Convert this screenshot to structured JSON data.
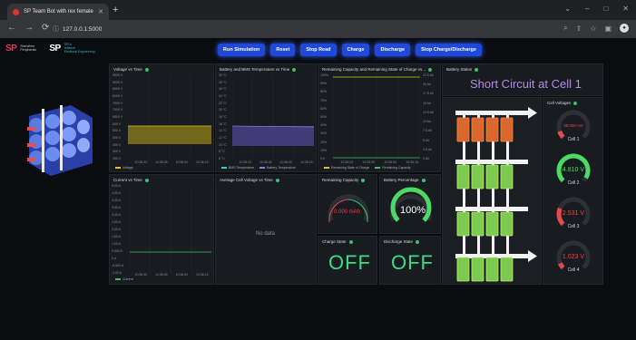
{
  "browser": {
    "tab_title": "SP Team Bot with rex female",
    "address": "127.0.0.1:5000",
    "new_tab": "+"
  },
  "header": {
    "logo_left_name": "Shenzhen Peripherals",
    "logo_sp": "SP",
    "logo_right_lines": [
      "SPLit",
      "Alliance",
      "Electrical Engineering"
    ]
  },
  "toolbar": {
    "buttons": [
      "Run Simulation",
      "Reset",
      "Stop Read",
      "Charge",
      "Discharge",
      "Stop Charge/Discharge"
    ]
  },
  "panels": {
    "voltage": {
      "title": "Voltage vs Time",
      "y_ticks": [
        "9500 V",
        "9000 V",
        "8500 V",
        "8000 V",
        "7500 V",
        "7000 V",
        "6500 V",
        "600 V",
        "550 V",
        "500 V",
        "450 V",
        "400 V",
        "350 V"
      ],
      "x_ticks": [
        "10:35:23",
        "10:35:45",
        "10:36:00",
        "10:36:15"
      ],
      "legend": "Voltage"
    },
    "temperature": {
      "title": "Battery and BMS Temperature vs Time",
      "y_ticks": [
        "30 °C",
        "28 °C",
        "26 °C",
        "24 °C",
        "22 °C",
        "20 °C",
        "18 °C",
        "16 °C",
        "14 °C",
        "12 °C",
        "10 °C",
        "8 °C",
        "6 °C"
      ],
      "x_ticks": [
        "10:35:23",
        "10:35:45",
        "10:36:00",
        "10:36:15"
      ],
      "legend": [
        "BMS Temperature",
        "Battery Temperature"
      ]
    },
    "capacity": {
      "title": "Remaining Capacity and Remaining State of Charge vs...",
      "y_left": [
        "100%",
        "90%",
        "80%",
        "70%",
        "60%",
        "50%",
        "40%",
        "30%",
        "20%",
        "10%",
        "0%"
      ],
      "y_right": [
        "22.5 Ah",
        "20 Ah",
        "17.5 Ah",
        "15 Ah",
        "12.5 Ah",
        "10 Ah",
        "7.5 Ah",
        "5 Ah",
        "2.5 Ah",
        "0 Ah"
      ],
      "x_ticks": [
        "10:35:23",
        "10:35:45",
        "10:36:00",
        "10:36:15"
      ],
      "legend": [
        "Remaining State of Charge",
        "Remaining Capacity"
      ]
    },
    "current": {
      "title": "Current vs Time",
      "y_ticks": [
        "5.00 A",
        "4.50 A",
        "4.00 A",
        "3.50 A",
        "3.00 A",
        "2.50 A",
        "2.00 A",
        "1.50 A",
        "1.00 A",
        "0.500 A",
        "0 A",
        "-0.500 A",
        "-1.00 A"
      ],
      "x_ticks": [
        "10:35:30",
        "10:35:45",
        "10:36:00",
        "10:36:15"
      ],
      "legend": "Current"
    },
    "avg_cell": {
      "title": "Average Cell Voltage vs Time",
      "nodata": "No data"
    },
    "remaining_capacity": {
      "title": "Remaining Capacity",
      "value": "0.000 mAh",
      "fraction": 0
    },
    "battery_percentage": {
      "title": "Battery Percentage",
      "value": "100%",
      "fraction": 1
    },
    "charge_state": {
      "title": "Charge State",
      "value": "OFF"
    },
    "discharge_state": {
      "title": "Discharge State",
      "value": "OFF"
    },
    "battery_status": {
      "title": "Battery Status",
      "message": "Short Circuit at Cell 1"
    },
    "cell_voltages": {
      "title": "Cell Voltages",
      "cells": [
        {
          "label": "Cell 1",
          "value": "39.000 mV",
          "fraction": 0.1,
          "color": "#e34b4b"
        },
        {
          "label": "Cell 2",
          "value": "4.810 V",
          "fraction": 0.95,
          "color": "#4cd964"
        },
        {
          "label": "Cell 3",
          "value": "2.531 V",
          "fraction": 0.25,
          "color": "#e34b4b"
        },
        {
          "label": "Cell 4",
          "value": "1.023 V",
          "fraction": 0.08,
          "color": "#e34b4b"
        }
      ]
    }
  },
  "colors": {
    "accent": "#1f49d8",
    "ok": "#3ddc84",
    "fault": "#e34b4b",
    "voltage_fill": "#8a7a1a",
    "temp_fill": "#4b3f8a",
    "status_text": "#b78be8"
  }
}
